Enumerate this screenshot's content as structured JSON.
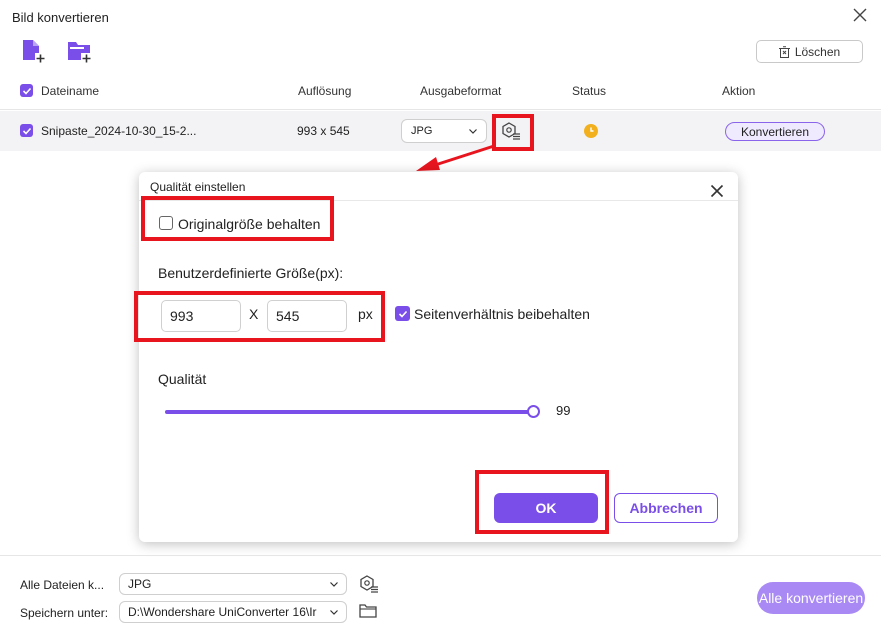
{
  "window": {
    "title": "Bild konvertieren"
  },
  "toolbar": {
    "add_file_icon": "add-file-icon",
    "add_folder_icon": "add-folder-icon",
    "clear_label": "Löschen"
  },
  "table": {
    "headers": {
      "filename": "Dateiname",
      "resolution": "Auflösung",
      "format": "Ausgabeformat",
      "status": "Status",
      "action": "Aktion"
    },
    "rows": [
      {
        "filename": "Snipaste_2024-10-30_15-2...",
        "resolution": "993 x 545",
        "format": "JPG",
        "convert_label": "Konvertieren"
      }
    ]
  },
  "dialog": {
    "title": "Qualität einstellen",
    "keep_original_label": "Originalgröße behalten",
    "custom_size_label": "Benutzerdefinierte Größe(px):",
    "width": "993",
    "separator": "X",
    "height": "545",
    "unit": "px",
    "keep_ratio_label": "Seitenverhältnis beibehalten",
    "quality_label": "Qualität",
    "quality_value": "99",
    "ok_label": "OK",
    "cancel_label": "Abbrechen"
  },
  "footer": {
    "all_files_label": "Alle Dateien k...",
    "all_files_format": "JPG",
    "save_label": "Speichern unter:",
    "save_path": "D:\\Wondershare UniConverter 16\\Ir",
    "convert_all_label": "Alle konvertieren"
  },
  "colors": {
    "accent": "#7a4ee8",
    "highlight": "#e8151f",
    "status": "#f2b01e"
  }
}
